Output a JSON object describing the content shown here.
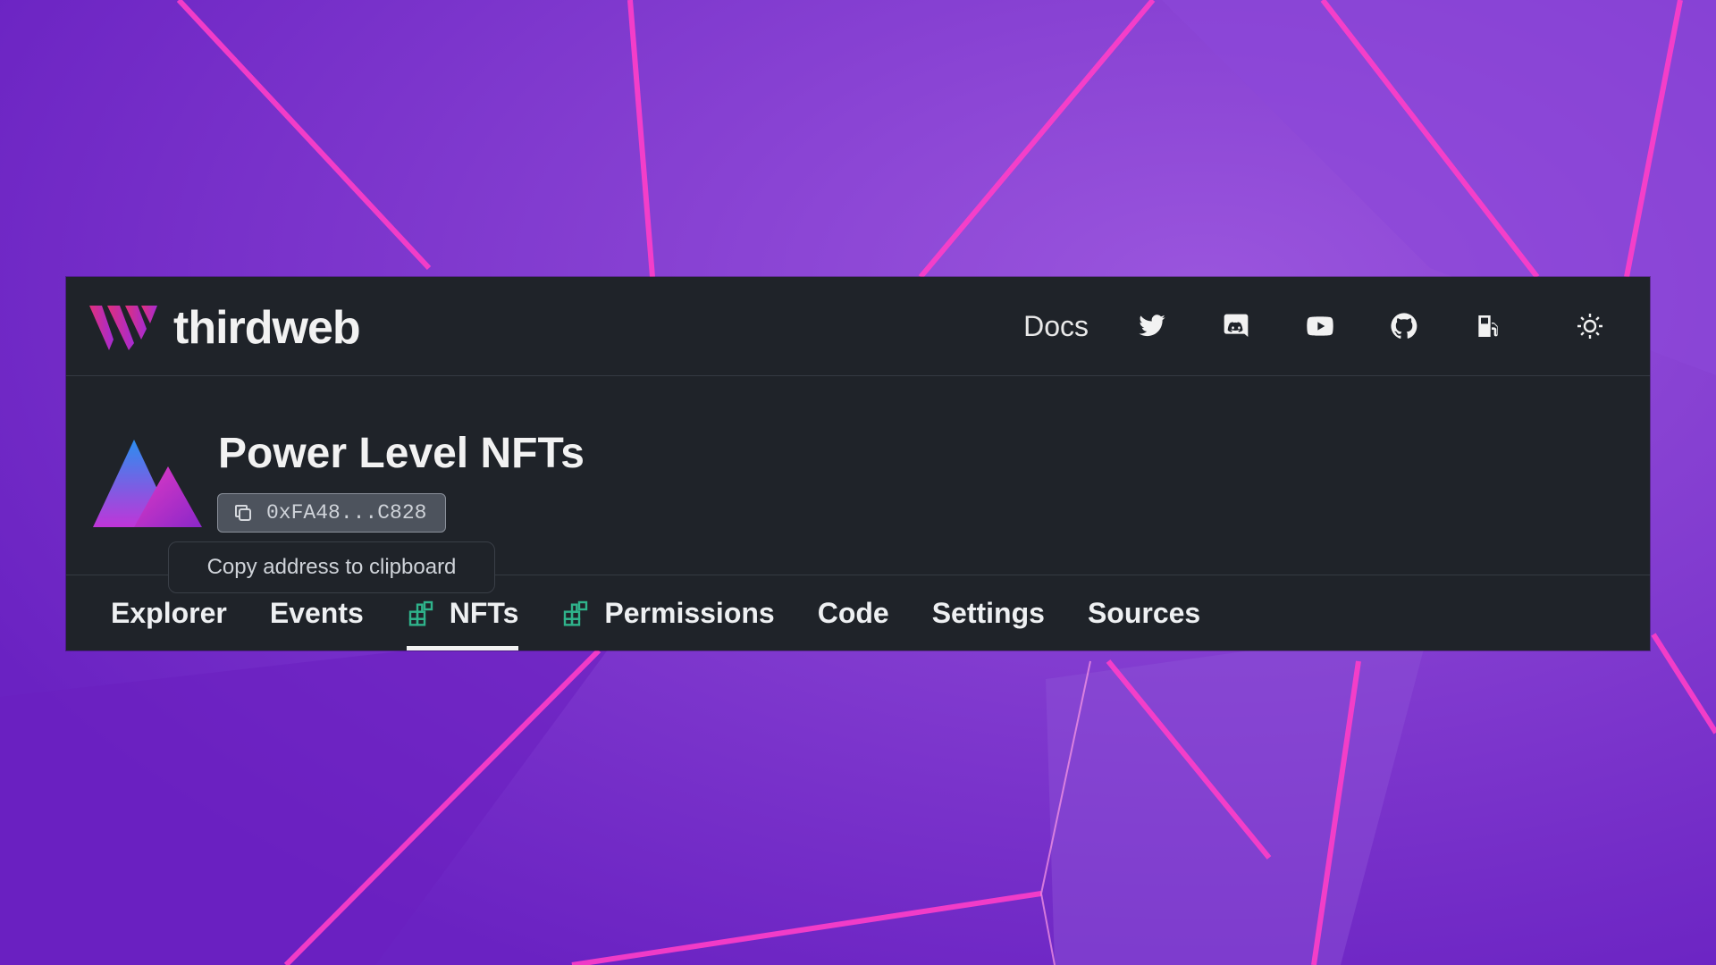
{
  "header": {
    "brand": "thirdweb",
    "docs_label": "Docs",
    "icons": [
      "twitter-icon",
      "discord-icon",
      "youtube-icon",
      "github-icon",
      "gas-station-icon",
      "sun-icon"
    ]
  },
  "contract": {
    "title": "Power Level NFTs",
    "address": "0xFA48...C828",
    "tooltip": "Copy address to clipboard"
  },
  "tabs": [
    {
      "label": "Explorer",
      "icon": null,
      "active": false
    },
    {
      "label": "Events",
      "icon": null,
      "active": false
    },
    {
      "label": "NFTs",
      "icon": "extension-icon",
      "active": true
    },
    {
      "label": "Permissions",
      "icon": "extension-icon",
      "active": false
    },
    {
      "label": "Code",
      "icon": null,
      "active": false
    },
    {
      "label": "Settings",
      "icon": null,
      "active": false
    },
    {
      "label": "Sources",
      "icon": null,
      "active": false
    }
  ],
  "colors": {
    "panel": "#1f2329",
    "accent_green": "#2fb38b",
    "background": "#7a2fd0",
    "neon": "#ff3ec8"
  }
}
